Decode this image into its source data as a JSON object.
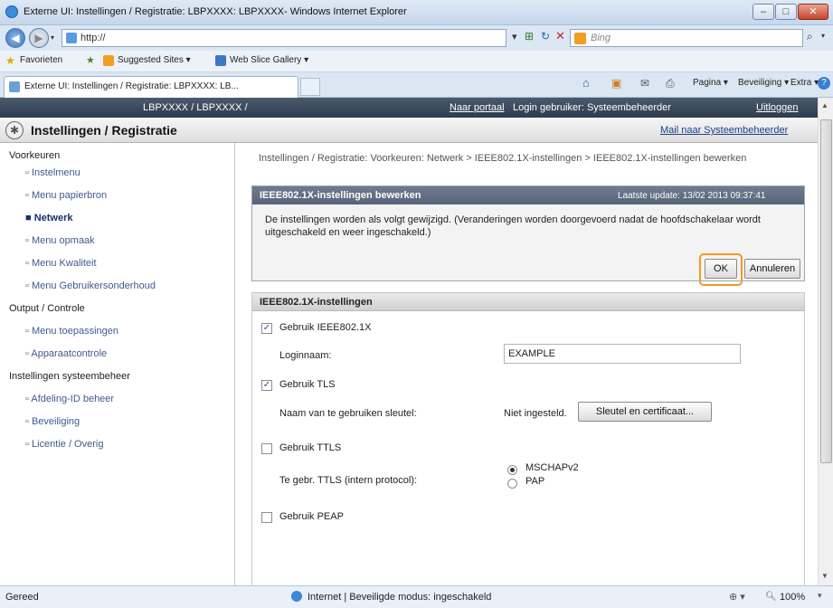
{
  "window": {
    "title": "Externe UI: Instellingen / Registratie: LBPXXXX: LBPXXXX- Windows Internet Explorer",
    "buttons": [
      "–",
      "□",
      "✕"
    ]
  },
  "address_bar": {
    "url": "http://",
    "search_placeholder": "Bing"
  },
  "favorites_bar": {
    "favorites_label": "Favorieten",
    "items": [
      "Suggested Sites ▾",
      "Web Slice Gallery ▾"
    ]
  },
  "tab": {
    "title": "Externe UI: Instellingen / Registratie: LBPXXXX: LB..."
  },
  "command_bar": {
    "items": [
      "Pagina ▾",
      "Beveiliging ▾",
      "Extra ▾"
    ]
  },
  "header": {
    "device": "LBPXXXX / LBPXXXX /",
    "portal_link": "Naar portaal",
    "login_label": "Login gebruiker: Systeembeheerder",
    "logout_link": "Uitloggen",
    "page_title": "Instellingen / Registratie",
    "mail_link": "Mail naar Systeembeheerder"
  },
  "sidebar": {
    "sections": [
      {
        "title": "Voorkeuren",
        "items": [
          "Instelmenu",
          "Menu papierbron",
          "Netwerk",
          "Menu opmaak",
          "Menu Kwaliteit",
          "Menu Gebruikersonderhoud"
        ]
      },
      {
        "title": "Output / Controle",
        "items": [
          "Menu toepassingen",
          "Apparaatcontrole"
        ]
      },
      {
        "title": "Instellingen systeembeheer",
        "items": [
          "Afdeling-ID beheer",
          "Beveiliging",
          "Licentie / Overig"
        ]
      }
    ],
    "active_item": "Netwerk"
  },
  "main": {
    "breadcrumb": "Instellingen / Registratie: Voorkeuren: Netwerk > IEEE802.1X-instellingen > IEEE802.1X-instellingen bewerken",
    "edit_panel": {
      "title": "IEEE802.1X-instellingen bewerken",
      "last_update": "Laatste update: 13/02 2013 09:37:41",
      "message": "De instellingen worden als volgt gewijzigd. (Veranderingen worden doorgevoerd nadat de hoofdschakelaar wordt uitgeschakeld en weer ingeschakeld.)",
      "ok_label": "OK",
      "cancel_label": "Annuleren"
    },
    "settings": {
      "title": "IEEE802.1X-instellingen",
      "use_ieee": {
        "label": "Gebruik IEEE802.1X",
        "checked": true
      },
      "login_name_label": "Loginnaam:",
      "login_name_value": "EXAMPLE",
      "use_tls": {
        "label": "Gebruik TLS",
        "checked": true
      },
      "key_label": "Naam van te gebruiken sleutel:",
      "key_value": "Niet ingesteld.",
      "key_button": "Sleutel en certificaat...",
      "use_ttls": {
        "label": "Gebruik TTLS",
        "checked": false
      },
      "ttls_protocol_label": "Te gebr. TTLS (intern protocol):",
      "ttls_options": [
        "MSCHAPv2",
        "PAP"
      ],
      "ttls_selected": "MSCHAPv2",
      "use_peap": {
        "label": "Gebruik PEAP",
        "checked": false
      }
    }
  },
  "status_bar": {
    "left": "Gereed",
    "zone": "Internet | Beveiligde modus: ingeschakeld",
    "zoom": "100%"
  }
}
